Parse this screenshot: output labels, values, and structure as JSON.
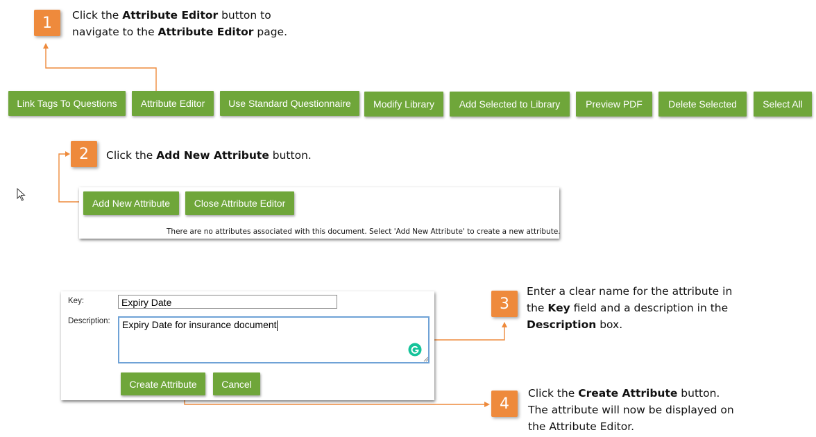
{
  "steps": [
    {
      "number": "1",
      "pre": "Click the ",
      "bold1": "Attribute Editor",
      "mid": " button to navigate to the ",
      "bold2": "Attribute Editor",
      "post": " page."
    },
    {
      "number": "2",
      "pre": "Click the ",
      "bold1": "Add New Attribute",
      "post": " button."
    },
    {
      "number": "3",
      "pre": "Enter a clear name for the attribute in the ",
      "bold1": "Key",
      "mid": " field and a description in the ",
      "bold2": "Description",
      "post": " box."
    },
    {
      "number": "4",
      "pre": "Click the ",
      "bold1": "Create Attribute",
      "post": " button. The attribute will now be displayed on the Attribute Editor."
    }
  ],
  "toolbar": {
    "buttons": [
      "Link Tags To Questions",
      "Attribute Editor",
      "Use Standard Questionnaire",
      "Modify Library",
      "Add Selected to Library",
      "Preview PDF",
      "Delete Selected",
      "Select All"
    ]
  },
  "attribute_panel": {
    "add_button": "Add New Attribute",
    "close_button": "Close Attribute Editor",
    "empty_message": "There are no attributes associated with this document. Select 'Add New Attribute' to create a new attribute."
  },
  "form": {
    "key_label": "Key:",
    "key_value": "Expiry Date",
    "description_label": "Description:",
    "description_value": "Expiry Date for insurance document",
    "create_button": "Create Attribute",
    "cancel_button": "Cancel"
  },
  "colors": {
    "accent": "#ee8a3c",
    "button_green": "#6fa63a"
  },
  "icons": {
    "cursor": "mouse-pointer-icon",
    "grammar": "grammarly-icon"
  }
}
